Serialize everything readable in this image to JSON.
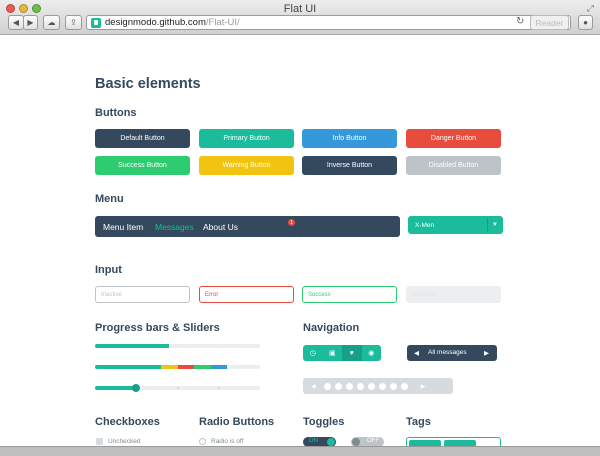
{
  "window": {
    "title": "Flat UI",
    "url_host": "designmodo.github.com",
    "url_path": "/Flat-UI/",
    "reader_label": "Reader",
    "reload_icon": "reload-icon"
  },
  "page": {
    "title": "Basic elements"
  },
  "sections": {
    "buttons": "Buttons",
    "menu": "Menu",
    "input": "Input",
    "progress": "Progress bars & Sliders",
    "navigation": "Navigation",
    "checkboxes": "Checkboxes",
    "radio": "Radio Buttons",
    "toggles": "Toggles",
    "tags": "Tags"
  },
  "buttons": [
    {
      "label": "Default Button",
      "color": "#34495e"
    },
    {
      "label": "Primary Button",
      "color": "#1abc9c"
    },
    {
      "label": "Info Button",
      "color": "#3498db"
    },
    {
      "label": "Danger Button",
      "color": "#e74c3c"
    },
    {
      "label": "Success Button",
      "color": "#2ecc71"
    },
    {
      "label": "Warning Button",
      "color": "#f1c40f"
    },
    {
      "label": "Inverse Button",
      "color": "#34495e"
    },
    {
      "label": "Disabled Button",
      "color": "#bdc3c7"
    }
  ],
  "menu": {
    "items": [
      "Menu Item",
      "Messages",
      "About Us"
    ],
    "badge": "1",
    "select_value": "X-Men"
  },
  "inputs": [
    {
      "placeholder": "Inactive",
      "state": "inactive"
    },
    {
      "placeholder": "Error",
      "state": "error"
    },
    {
      "placeholder": "Success",
      "state": "success"
    },
    {
      "placeholder": "Disabled",
      "state": "disabled"
    }
  ],
  "progress": {
    "bar1_percent": 45,
    "multi_segments": [
      {
        "percent": 40,
        "color": "#1abc9c"
      },
      {
        "percent": 10,
        "color": "#f1c40f"
      },
      {
        "percent": 10,
        "color": "#e74c3c"
      },
      {
        "percent": 10,
        "color": "#2ecc71"
      },
      {
        "percent": 10,
        "color": "#3498db"
      }
    ],
    "slider_percent": 25
  },
  "navigation": {
    "pager_label": "All messages"
  },
  "checkboxes": {
    "first_label": "Unchecked"
  },
  "radio": {
    "first_label": "Radio is off"
  },
  "toggles": {
    "on_label": "ON",
    "off_label": "OFF"
  }
}
